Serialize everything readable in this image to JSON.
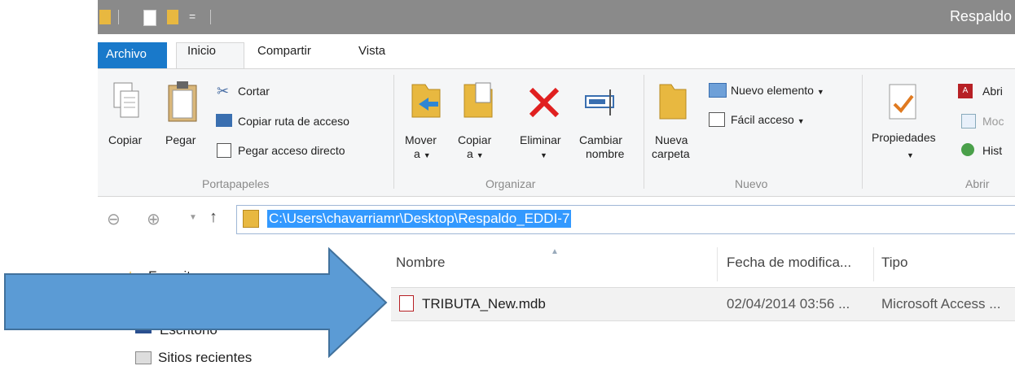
{
  "window": {
    "title": "Respaldo"
  },
  "tabs": {
    "archivo": "Archivo",
    "inicio": "Inicio",
    "compartir": "Compartir",
    "vista": "Vista"
  },
  "ribbon": {
    "portapapeles": {
      "label": "Portapapeles",
      "copiar": "Copiar",
      "pegar": "Pegar",
      "cortar": "Cortar",
      "copiar_ruta": "Copiar ruta de acceso",
      "pegar_acceso": "Pegar acceso directo"
    },
    "organizar": {
      "label": "Organizar",
      "mover_1": "Mover",
      "mover_2": "a",
      "copiar_1": "Copiar",
      "copiar_2": "a",
      "eliminar": "Eliminar",
      "cambiar_1": "Cambiar",
      "cambiar_2": "nombre"
    },
    "nuevo": {
      "label": "Nuevo",
      "nueva_1": "Nueva",
      "nueva_2": "carpeta",
      "nuevo_elemento": "Nuevo elemento",
      "facil_acceso": "Fácil acceso"
    },
    "abrir": {
      "label": "Abrir",
      "propiedades": "Propiedades",
      "abrir": "Abri",
      "modificar": "Moc",
      "historial": "Hist"
    }
  },
  "address": {
    "path": "C:\\Users\\chavarriamr\\Desktop\\Respaldo_EDDI-7"
  },
  "columns": {
    "nombre": "Nombre",
    "fecha": "Fecha de modifica...",
    "tipo": "Tipo"
  },
  "files": [
    {
      "name": "TRIBUTA_New.mdb",
      "date": "02/04/2014 03:56 ...",
      "type": "Microsoft Access ..."
    }
  ],
  "nav_pane": {
    "favoritos": "Favoritos",
    "escritorio": "Escritorio",
    "sitios": "Sitios recientes"
  },
  "colors": {
    "accent": "#1979ca",
    "arrow": "#5b9bd5",
    "selection": "#3399ff"
  }
}
